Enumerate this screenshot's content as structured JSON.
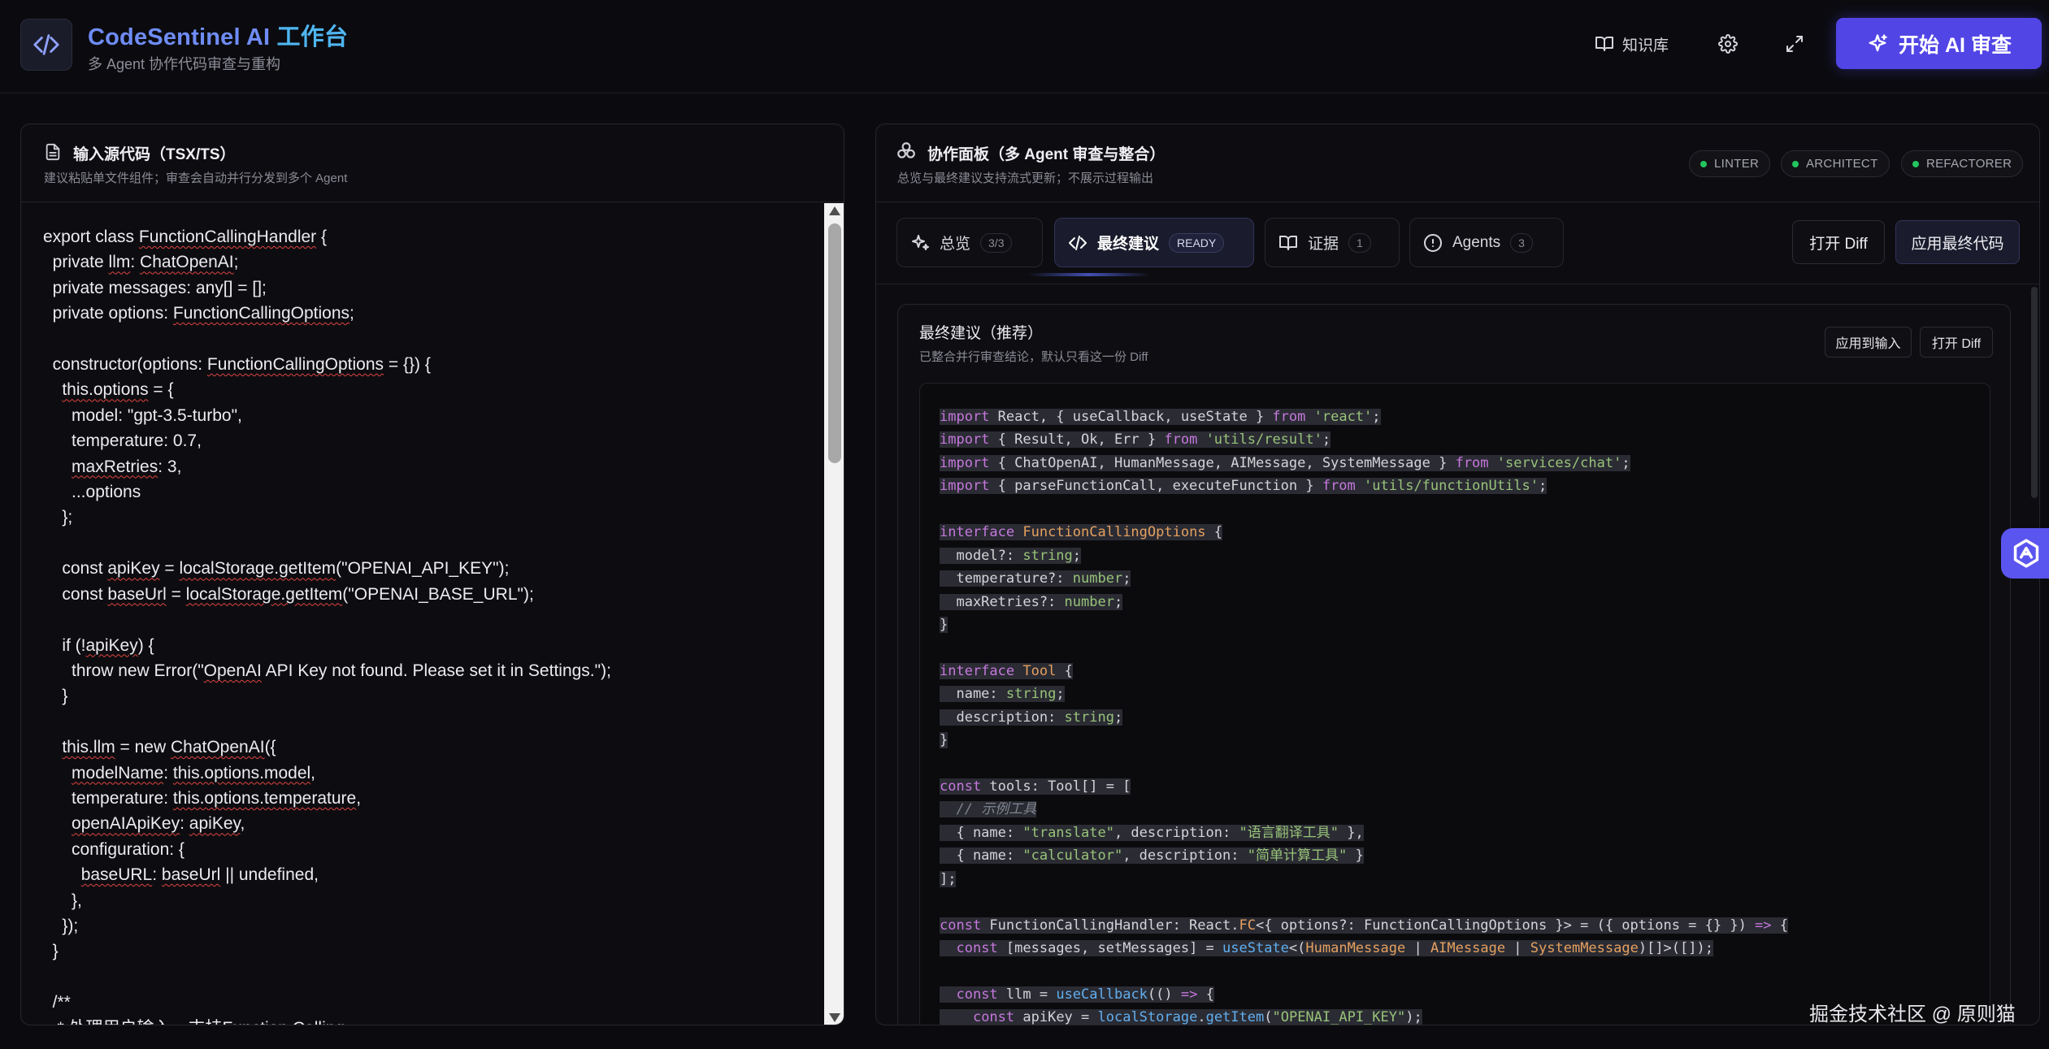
{
  "header": {
    "title_en": "CodeSentinel AI ",
    "title_cn": "工作台",
    "subtitle": "多 Agent 协作代码审查与重构",
    "knowledge_label": "知识库",
    "start_label": "开始 AI 审查"
  },
  "left": {
    "title": "输入源代码（TSX/TS）",
    "subtitle": "建议粘贴单文件组件；审查会自动并行分发到多个 Agent",
    "code_lines": [
      [
        {
          "t": "export class "
        },
        {
          "t": "FunctionCallingHandler",
          "sq": true
        },
        {
          "t": " {"
        }
      ],
      [
        {
          "t": "  private "
        },
        {
          "t": "llm",
          "sq": true
        },
        {
          "t": ": "
        },
        {
          "t": "ChatOpenAI",
          "sq": true
        },
        {
          "t": ";"
        }
      ],
      [
        {
          "t": "  private messages: any[] = [];"
        }
      ],
      [
        {
          "t": "  private options: "
        },
        {
          "t": "FunctionCallingOptions",
          "sq": true
        },
        {
          "t": ";"
        }
      ],
      [
        {
          "t": ""
        }
      ],
      [
        {
          "t": "  constructor(options: "
        },
        {
          "t": "FunctionCallingOptions",
          "sq": true
        },
        {
          "t": " = {}) {"
        }
      ],
      [
        {
          "t": "    "
        },
        {
          "t": "this.options",
          "sq": true
        },
        {
          "t": " = {"
        }
      ],
      [
        {
          "t": "      model: \"gpt-3.5-turbo\","
        }
      ],
      [
        {
          "t": "      temperature: 0.7,"
        }
      ],
      [
        {
          "t": "      "
        },
        {
          "t": "maxRetries",
          "sq": true
        },
        {
          "t": ": 3,"
        }
      ],
      [
        {
          "t": "      ...options"
        }
      ],
      [
        {
          "t": "    };"
        }
      ],
      [
        {
          "t": ""
        }
      ],
      [
        {
          "t": "    const "
        },
        {
          "t": "apiKey",
          "sq": true
        },
        {
          "t": " = "
        },
        {
          "t": "localStorage.getItem",
          "sq": true
        },
        {
          "t": "(\"OPENAI_API_KEY\");"
        }
      ],
      [
        {
          "t": "    const "
        },
        {
          "t": "baseUrl",
          "sq": true
        },
        {
          "t": " = "
        },
        {
          "t": "localStorage.getItem",
          "sq": true
        },
        {
          "t": "(\"OPENAI_BASE_URL\");"
        }
      ],
      [
        {
          "t": ""
        }
      ],
      [
        {
          "t": "    if (!"
        },
        {
          "t": "apiKey",
          "sq": true
        },
        {
          "t": ") {"
        }
      ],
      [
        {
          "t": "      throw new Error(\""
        },
        {
          "t": "OpenAI",
          "sq": true
        },
        {
          "t": " API Key not found. Please set it in Settings.\");"
        }
      ],
      [
        {
          "t": "    }"
        }
      ],
      [
        {
          "t": ""
        }
      ],
      [
        {
          "t": "    "
        },
        {
          "t": "this.llm",
          "sq": true
        },
        {
          "t": " = new "
        },
        {
          "t": "ChatOpenAI",
          "sq": true
        },
        {
          "t": "({"
        }
      ],
      [
        {
          "t": "      "
        },
        {
          "t": "modelName",
          "sq": true
        },
        {
          "t": ": "
        },
        {
          "t": "this.options.model",
          "sq": true
        },
        {
          "t": ","
        }
      ],
      [
        {
          "t": "      temperature: "
        },
        {
          "t": "this.options.temperature",
          "sq": true
        },
        {
          "t": ","
        }
      ],
      [
        {
          "t": "      "
        },
        {
          "t": "openAIApiKey",
          "sq": true
        },
        {
          "t": ": "
        },
        {
          "t": "apiKey",
          "sq": true
        },
        {
          "t": ","
        }
      ],
      [
        {
          "t": "      configuration: {"
        }
      ],
      [
        {
          "t": "        "
        },
        {
          "t": "baseURL",
          "sq": true
        },
        {
          "t": ": "
        },
        {
          "t": "baseUrl",
          "sq": true
        },
        {
          "t": " || undefined,"
        }
      ],
      [
        {
          "t": "      },"
        }
      ],
      [
        {
          "t": "    });"
        }
      ],
      [
        {
          "t": "  }"
        }
      ],
      [
        {
          "t": ""
        }
      ],
      [
        {
          "t": "  /**"
        }
      ],
      [
        {
          "t": "   * 处理用户输入，支持Function Calling"
        }
      ]
    ]
  },
  "right": {
    "title": "协作面板（多 Agent 审查与整合）",
    "subtitle": "总览与最终建议支持流式更新；不展示过程输出",
    "agents": [
      "LINTER",
      "ARCHITECT",
      "REFACTORER"
    ],
    "tabs": [
      {
        "label": "总览",
        "badge": "3/3"
      },
      {
        "label": "最终建议",
        "badge": "READY"
      },
      {
        "label": "证据",
        "badge": "1"
      },
      {
        "label": "Agents",
        "badge": "3"
      }
    ],
    "open_diff": "打开 Diff",
    "apply_final": "应用最终代码",
    "suggestion": {
      "title": "最终建议（推荐）",
      "subtitle": "已整合并行审查结论，默认只看这一份 Diff",
      "apply_input": "应用到输入",
      "open_diff": "打开 Diff"
    },
    "code_lines": [
      [
        {
          "c": "kw",
          "t": "import"
        },
        {
          "t": " React, { useCallback, useState } "
        },
        {
          "c": "kw",
          "t": "from"
        },
        {
          "t": " "
        },
        {
          "c": "str",
          "t": "'react'"
        },
        {
          "t": ";"
        }
      ],
      [
        {
          "c": "kw",
          "t": "import"
        },
        {
          "t": " { Result, Ok, Err } "
        },
        {
          "c": "kw",
          "t": "from"
        },
        {
          "t": " "
        },
        {
          "c": "str",
          "t": "'utils/result'"
        },
        {
          "t": ";"
        }
      ],
      [
        {
          "c": "kw",
          "t": "import"
        },
        {
          "t": " { ChatOpenAI, HumanMessage, AIMessage, SystemMessage } "
        },
        {
          "c": "kw",
          "t": "from"
        },
        {
          "t": " "
        },
        {
          "c": "str",
          "t": "'services/chat'"
        },
        {
          "t": ";"
        }
      ],
      [
        {
          "c": "kw",
          "t": "import"
        },
        {
          "t": " { parseFunctionCall, executeFunction } "
        },
        {
          "c": "kw",
          "t": "from"
        },
        {
          "t": " "
        },
        {
          "c": "str",
          "t": "'utils/functionUtils'"
        },
        {
          "t": ";"
        }
      ],
      [],
      [
        {
          "c": "kw",
          "t": "interface"
        },
        {
          "t": " "
        },
        {
          "c": "typ",
          "t": "FunctionCallingOptions"
        },
        {
          "t": " {"
        }
      ],
      [
        {
          "t": "  model?: "
        },
        {
          "c": "bt",
          "t": "string"
        },
        {
          "t": ";"
        }
      ],
      [
        {
          "t": "  temperature?: "
        },
        {
          "c": "bt",
          "t": "number"
        },
        {
          "t": ";"
        }
      ],
      [
        {
          "t": "  maxRetries?: "
        },
        {
          "c": "bt",
          "t": "number"
        },
        {
          "t": ";"
        }
      ],
      [
        {
          "t": "}"
        }
      ],
      [],
      [
        {
          "c": "kw",
          "t": "interface"
        },
        {
          "t": " "
        },
        {
          "c": "typ",
          "t": "Tool"
        },
        {
          "t": " {"
        }
      ],
      [
        {
          "t": "  name: "
        },
        {
          "c": "bt",
          "t": "string"
        },
        {
          "t": ";"
        }
      ],
      [
        {
          "t": "  description: "
        },
        {
          "c": "bt",
          "t": "string"
        },
        {
          "t": ";"
        }
      ],
      [
        {
          "t": "}"
        }
      ],
      [],
      [
        {
          "c": "kw",
          "t": "const"
        },
        {
          "t": " tools: Tool[] = ["
        }
      ],
      [
        {
          "t": "  "
        },
        {
          "c": "cm",
          "t": "// 示例工具"
        }
      ],
      [
        {
          "t": "  { name: "
        },
        {
          "c": "str",
          "t": "\"translate\""
        },
        {
          "t": ", description: "
        },
        {
          "c": "str",
          "t": "\"语言翻译工具\""
        },
        {
          "t": " },"
        }
      ],
      [
        {
          "t": "  { name: "
        },
        {
          "c": "str",
          "t": "\"calculator\""
        },
        {
          "t": ", description: "
        },
        {
          "c": "str",
          "t": "\"简单计算工具\""
        },
        {
          "t": " }"
        }
      ],
      [
        {
          "t": "];"
        }
      ],
      [],
      [
        {
          "c": "kw",
          "t": "const"
        },
        {
          "t": " FunctionCallingHandler: React."
        },
        {
          "c": "typ",
          "t": "FC"
        },
        {
          "t": "<{ options?: FunctionCallingOptions }> = ({ options = {} }) "
        },
        {
          "c": "kw",
          "t": "=>"
        },
        {
          "t": " {"
        }
      ],
      [
        {
          "t": "  "
        },
        {
          "c": "kw",
          "t": "const"
        },
        {
          "t": " [messages, setMessages] = "
        },
        {
          "c": "fn",
          "t": "useState"
        },
        {
          "t": "<("
        },
        {
          "c": "typ",
          "t": "HumanMessage"
        },
        {
          "t": " | "
        },
        {
          "c": "typ",
          "t": "AIMessage"
        },
        {
          "t": " | "
        },
        {
          "c": "typ",
          "t": "SystemMessage"
        },
        {
          "t": ")[]>([]);"
        }
      ],
      [],
      [
        {
          "t": "  "
        },
        {
          "c": "kw",
          "t": "const"
        },
        {
          "t": " llm = "
        },
        {
          "c": "fn",
          "t": "useCallback"
        },
        {
          "t": "(() "
        },
        {
          "c": "kw",
          "t": "=>"
        },
        {
          "t": " {"
        }
      ],
      [
        {
          "t": "    "
        },
        {
          "c": "kw",
          "t": "const"
        },
        {
          "t": " apiKey = "
        },
        {
          "c": "fn",
          "t": "localStorage"
        },
        {
          "t": "."
        },
        {
          "c": "fn",
          "t": "getItem"
        },
        {
          "t": "("
        },
        {
          "c": "str",
          "t": "\"OPENAI_API_KEY\""
        },
        {
          "t": ");"
        }
      ]
    ]
  },
  "watermark": "掘金技术社区 @ 原则猫",
  "colors": {
    "accent": "#5145e6",
    "status_ok": "#22c55e"
  }
}
